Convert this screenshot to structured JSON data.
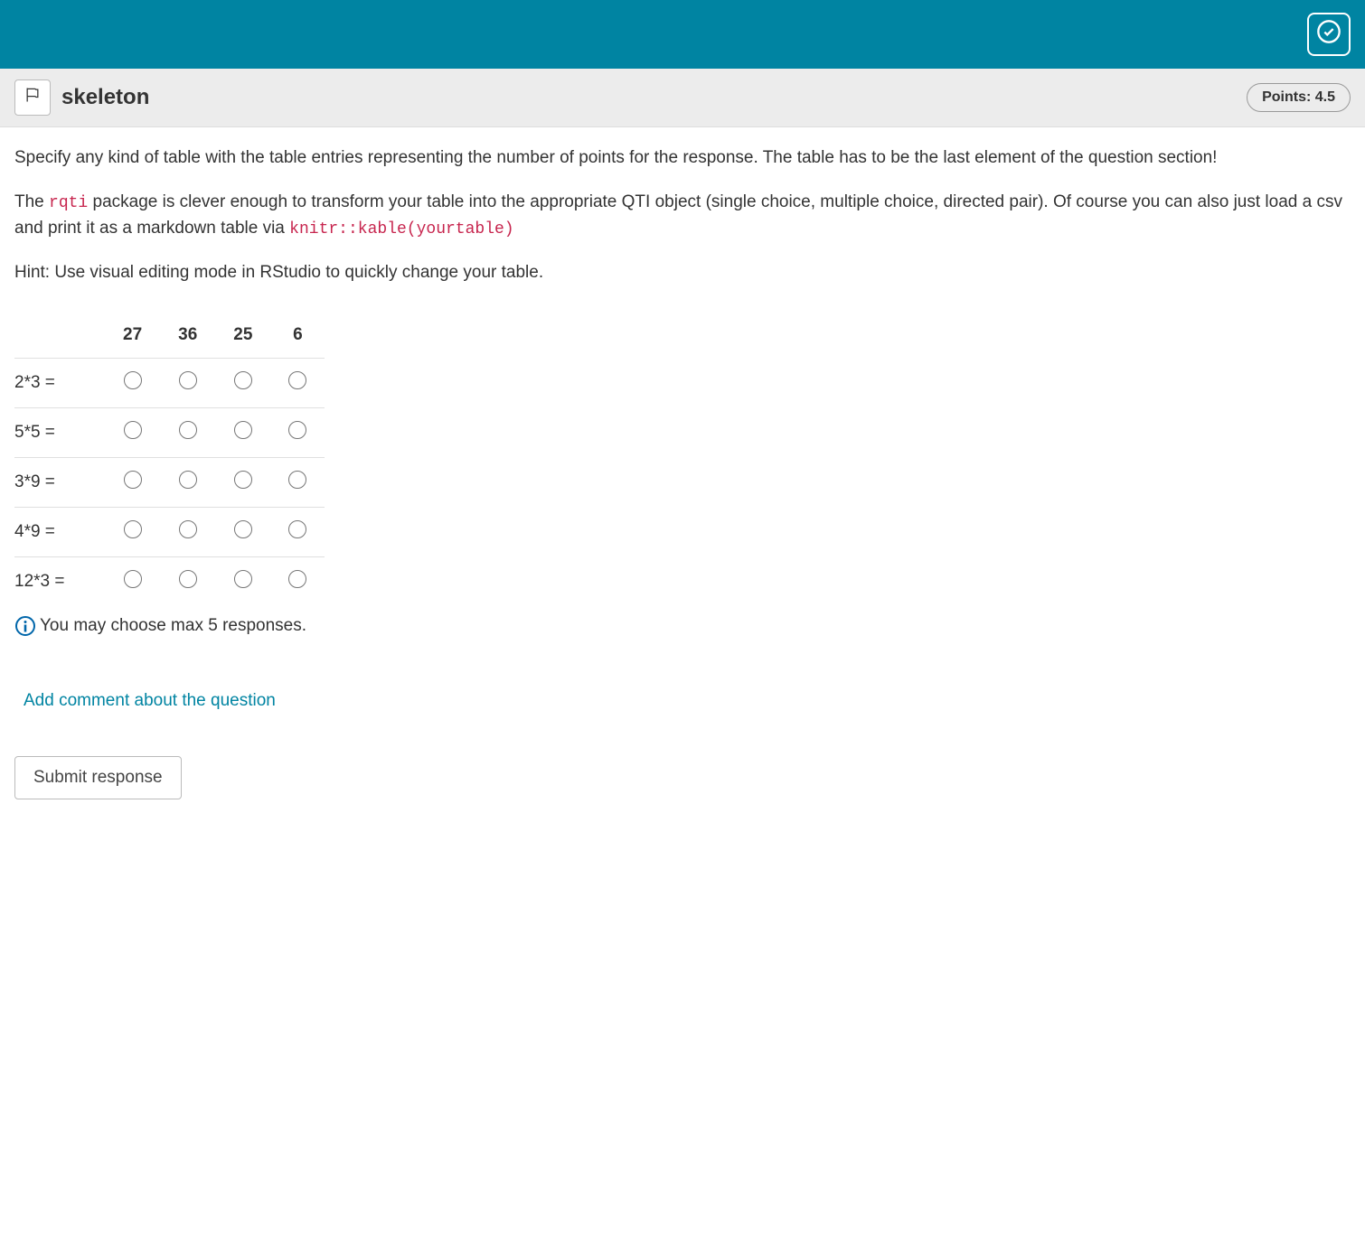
{
  "header": {
    "title": "skeleton",
    "points_label": "Points: 4.5"
  },
  "body": {
    "para1": "Specify any kind of table with the table entries representing the number of points for the response. The table has to be the last element of the question section!",
    "para2_prefix": "The ",
    "code1": "rqti",
    "para2_mid": " package is clever enough to transform your table into the appropriate QTI object (single choice, multiple choice, directed pair). Of course you can also just load a csv and print it as a markdown table via ",
    "code2": "knitr::kable(yourtable)",
    "para3": "Hint: Use visual editing mode in RStudio to quickly change your table."
  },
  "table": {
    "columns": [
      "27",
      "36",
      "25",
      "6"
    ],
    "rows": [
      "2*3 =",
      "5*5 =",
      "3*9 =",
      "4*9 =",
      "12*3 ="
    ]
  },
  "info_text": "You may choose max 5 responses.",
  "add_comment": "Add comment about the question",
  "submit_label": "Submit response"
}
